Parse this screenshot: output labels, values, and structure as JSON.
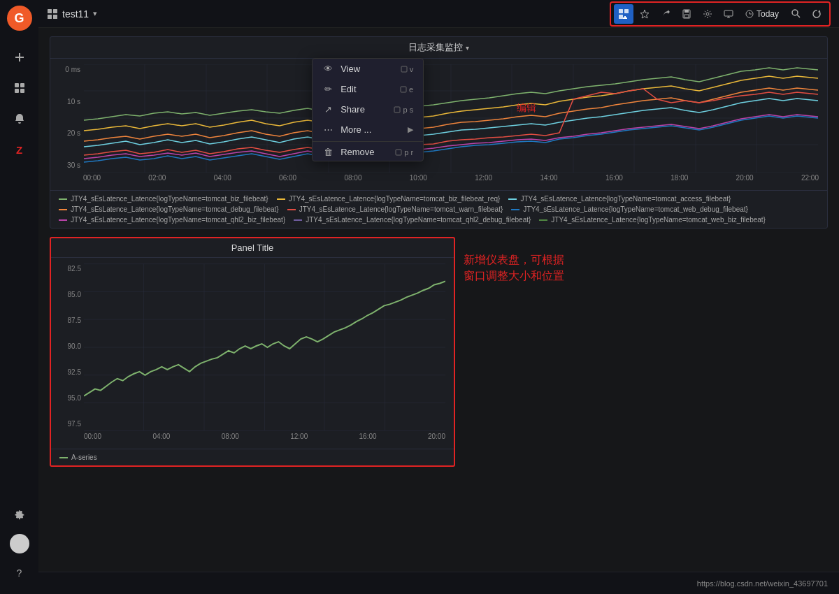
{
  "app": {
    "logo": "G",
    "logo_bg": "#f05a28"
  },
  "topbar": {
    "dashboard_name": "test11",
    "chevron": "▾",
    "add_panel_icon": "📊",
    "star_icon": "☆",
    "share_icon": "↗",
    "save_icon": "💾",
    "settings_icon": "⚙",
    "tv_icon": "🖥",
    "today_label": "Today",
    "search_icon": "🔍",
    "refresh_icon": "↻"
  },
  "panel1": {
    "title": "日志采集监控",
    "chevron": "▾",
    "context_menu": {
      "view_label": "View",
      "view_shortcut": "v",
      "edit_label": "Edit",
      "edit_shortcut": "e",
      "share_label": "Share",
      "share_shortcut": "p s",
      "more_label": "More ...",
      "remove_label": "Remove",
      "remove_shortcut": "p r"
    },
    "annotation_edit": "编辑",
    "y_axis_labels": [
      "30 s",
      "20 s",
      "10 s",
      "0 ms"
    ],
    "x_axis_labels": [
      "00:00",
      "02:00",
      "04:00",
      "06:00",
      "08:00",
      "10:00",
      "12:00",
      "14:00",
      "16:00",
      "18:00",
      "20:00",
      "22:00"
    ],
    "legend_items": [
      {
        "color": "#7eb26d",
        "label": "JTY4_sEsLatence_Latence{logTypeName=tomcat_biz_filebeat}"
      },
      {
        "color": "#eab839",
        "label": "JTY4_sEsLatence_Latence{logTypeName=tomcat_biz_filebeat_req}"
      },
      {
        "color": "#6ed0e0",
        "label": "JTY4_sEsLatence_Latence{logTypeName=tomcat_access_filebeat}"
      },
      {
        "color": "#ef843c",
        "label": "JTY4_sEsLatence_Latence{logTypeName=tomcat_debug_filebeat}"
      },
      {
        "color": "#e24d42",
        "label": "JTY4_sEsLatence_Latence{logTypeName=tomcat_warn_filebeat}"
      },
      {
        "color": "#1f78c1",
        "label": "JTY4_sEsLatence_Latence{logTypeName=tomcat_web_debug_filebeat}"
      },
      {
        "color": "#ba43a9",
        "label": "JTY4_sEsLatence_Latence{logTypeName=tomcat_qhl2_biz_filebeat}"
      },
      {
        "color": "#705da0",
        "label": "JTY4_sEsLatence_Latence{logTypeName=tomcat_qhl2_debug_filebeat}"
      },
      {
        "color": "#508642",
        "label": "JTY4_sEsLatence_Latence{logTypeName=tomcat_web_biz_filebeat}"
      }
    ]
  },
  "panel2": {
    "title": "Panel Title",
    "annotation_title": "新增仪表盘，可根据",
    "annotation_subtitle": "窗口调整大小和位置",
    "y_axis_labels": [
      "97.5",
      "95.0",
      "92.5",
      "90.0",
      "87.5",
      "85.0",
      "82.5"
    ],
    "x_axis_labels": [
      "00:00",
      "04:00",
      "08:00",
      "12:00",
      "16:00",
      "20:00"
    ],
    "legend_items": [
      {
        "color": "#7eb26d",
        "label": "A-series"
      }
    ]
  },
  "footer": {
    "url": "https://blog.csdn.net/weixin_43697701"
  },
  "sidebar": {
    "items": [
      {
        "icon": "⊞",
        "name": "dashboard"
      },
      {
        "icon": "+",
        "name": "add"
      },
      {
        "icon": "◫",
        "name": "apps"
      },
      {
        "icon": "🔔",
        "name": "alerts"
      },
      {
        "icon": "Z",
        "name": "zabbix"
      },
      {
        "icon": "⚙",
        "name": "settings"
      }
    ]
  }
}
